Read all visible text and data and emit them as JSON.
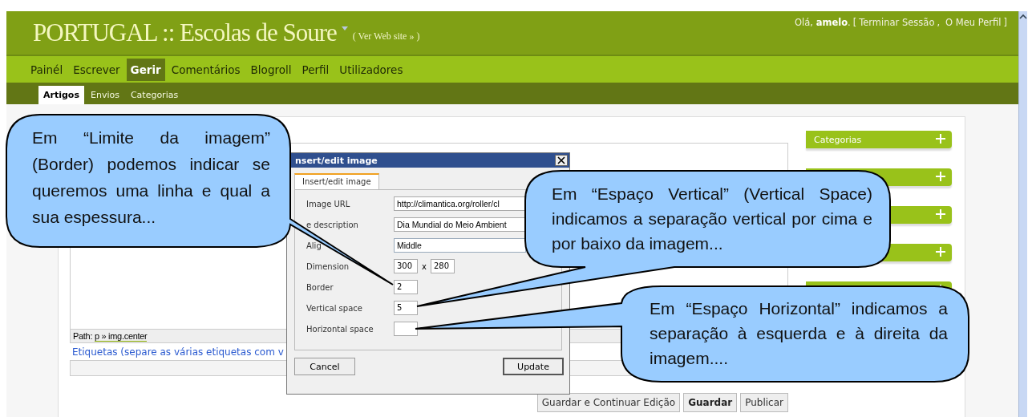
{
  "header": {
    "site_title": "PORTUGAL :: Escolas de Soure",
    "site_link": "( Ver Web site » )",
    "greeting": "Olá, **amelo**.",
    "open": "[",
    "links": [
      "Terminar Sessão",
      "O Meu Perfil"
    ],
    "separator": ",",
    "close": "]"
  },
  "nav": [
    {
      "label": "Painél",
      "selected": false
    },
    {
      "label": "Escrever",
      "selected": false
    },
    {
      "label": "Gerir",
      "selected": true
    },
    {
      "label": "Comentários",
      "selected": false
    },
    {
      "label": "Blogroll",
      "selected": false
    },
    {
      "label": "Perfil",
      "selected": false
    },
    {
      "label": "Utilizadores",
      "selected": false
    }
  ],
  "subnav": [
    {
      "label": "Artigos",
      "selected": true
    },
    {
      "label": "Envios",
      "selected": false
    },
    {
      "label": "Categorias",
      "selected": false
    }
  ],
  "editor": {
    "path_label": "Path:",
    "path": "p » img.center",
    "tags_label": "Etiquetas (separe as várias etiquetas com v"
  },
  "buttons": [
    {
      "label": "Guardar e Continuar Edição",
      "kind": "normal"
    },
    {
      "label": "Guardar",
      "kind": "primary"
    },
    {
      "label": "Publicar",
      "kind": "normal"
    }
  ],
  "widgets": [
    {
      "title": "Categorias",
      "expanded": false
    },
    {
      "expanded": false
    },
    {
      "expanded": false
    },
    {
      "expanded": false
    },
    {
      "expanded": false
    }
  ],
  "dialog": {
    "title": "nsert/edit image",
    "tabs": [
      {
        "label": "Insert/edit image",
        "selected": true
      }
    ],
    "fields": [
      {
        "label": "Image URL",
        "kind": "text",
        "value": "http://climantica.org/roller/cl"
      },
      {
        "label": "e description",
        "kind": "text",
        "value": "Dia Mundial do Meio Ambient"
      },
      {
        "label": "Alig",
        "kind": "select",
        "value": "Middle"
      },
      {
        "label": "Dimension",
        "kind": "size",
        "values": [
          "300",
          "280"
        ],
        "separator": "x"
      },
      {
        "label": "Border",
        "kind": "small",
        "value": "2"
      },
      {
        "label": "Vertical space",
        "kind": "small",
        "value": "5"
      },
      {
        "label": "Horizontal space",
        "kind": "small"
      }
    ],
    "buttons": [
      {
        "label": "Cancel",
        "kind": "normal"
      },
      {
        "label": "Update",
        "kind": "primary"
      }
    ]
  },
  "callouts": [
    {
      "text": "Em “Limite da imagem” (Border) podemos indicar se queremos uma linha e qual a sua espessura..."
    },
    {
      "text": "Em “Espaço Vertical” (Vertical Space) indicamos a separação vertical por cima e por baixo da imagem..."
    },
    {
      "text": "Em “Espaço Horizontal” indicamos a separação à esquerda e à direita da imagem...."
    }
  ]
}
